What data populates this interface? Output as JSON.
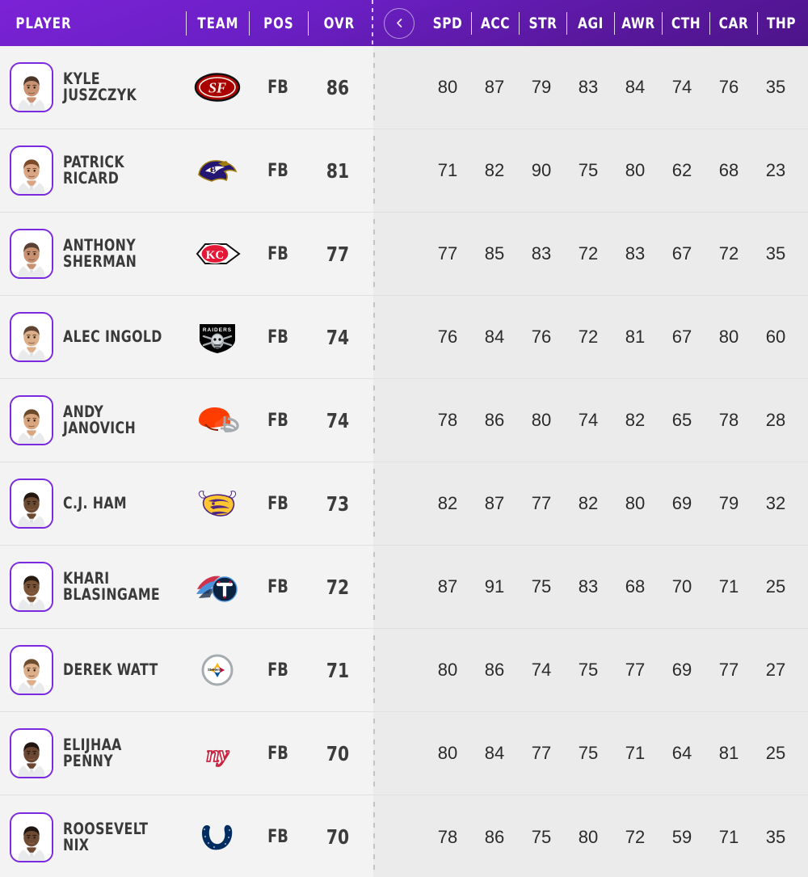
{
  "header": {
    "player_label": "PLAYER",
    "team_label": "TEAM",
    "pos_label": "POS",
    "ovr_label": "OVR",
    "collapse_icon": "chevron-left-icon",
    "stat_labels": [
      "SPD",
      "ACC",
      "STR",
      "AGI",
      "AWR",
      "CTH",
      "CAR",
      "THP"
    ],
    "accent_color": "#7b22d6",
    "accent_color_dark": "#4c1489"
  },
  "theme": {
    "avatar_border": "#7b2ae0",
    "row_bg_left": "#f3f3f3",
    "row_bg_right": "#ebebeb",
    "row_divider": "#e0e0e0",
    "text_color": "#3a3a3a"
  },
  "rows": [
    {
      "name_line1": "KYLE",
      "name_line2": "JUSZCZYK",
      "team": "San Francisco 49ers",
      "team_logo": "49ers-logo",
      "pos": "FB",
      "ovr": "86",
      "stats": [
        "80",
        "87",
        "79",
        "83",
        "84",
        "74",
        "76",
        "35"
      ],
      "avatar": "headshot-kyle-juszczyk",
      "skin": "#c99273",
      "hair": "#4a3526"
    },
    {
      "name_line1": "PATRICK",
      "name_line2": "RICARD",
      "team": "Baltimore Ravens",
      "team_logo": "ravens-logo",
      "pos": "FB",
      "ovr": "81",
      "stats": [
        "71",
        "82",
        "90",
        "75",
        "80",
        "62",
        "68",
        "23"
      ],
      "avatar": "headshot-patrick-ricard",
      "skin": "#d9a583",
      "hair": "#7a4a2a"
    },
    {
      "name_line1": "ANTHONY",
      "name_line2": "SHERMAN",
      "team": "Kansas City Chiefs",
      "team_logo": "chiefs-logo",
      "pos": "FB",
      "ovr": "77",
      "stats": [
        "77",
        "85",
        "83",
        "72",
        "83",
        "67",
        "72",
        "35"
      ],
      "avatar": "headshot-anthony-sherman",
      "skin": "#c89171",
      "hair": "#584032"
    },
    {
      "name_line1": "ALEC  INGOLD",
      "name_line2": "",
      "team": "Las Vegas Raiders",
      "team_logo": "raiders-logo",
      "pos": "FB",
      "ovr": "74",
      "stats": [
        "76",
        "84",
        "76",
        "72",
        "81",
        "67",
        "80",
        "60"
      ],
      "avatar": "headshot-alec-ingold",
      "skin": "#dcaf8b",
      "hair": "#5e4430"
    },
    {
      "name_line1": "ANDY",
      "name_line2": "JANOVICH",
      "team": "Cleveland Browns",
      "team_logo": "browns-logo",
      "pos": "FB",
      "ovr": "74",
      "stats": [
        "78",
        "86",
        "80",
        "74",
        "82",
        "65",
        "78",
        "28"
      ],
      "avatar": "headshot-andy-janovich",
      "skin": "#d8a57f",
      "hair": "#6b4a2c"
    },
    {
      "name_line1": "C.J.  HAM",
      "name_line2": "",
      "team": "Minnesota Vikings",
      "team_logo": "vikings-logo",
      "pos": "FB",
      "ovr": "73",
      "stats": [
        "82",
        "87",
        "77",
        "82",
        "80",
        "69",
        "79",
        "32"
      ],
      "avatar": "headshot-cj-ham",
      "skin": "#6d4a32",
      "hair": "#241710"
    },
    {
      "name_line1": "KHARI",
      "name_line2": "BLASINGAME",
      "team": "Tennessee Titans",
      "team_logo": "titans-logo",
      "pos": "FB",
      "ovr": "72",
      "stats": [
        "87",
        "91",
        "75",
        "83",
        "68",
        "70",
        "71",
        "25"
      ],
      "avatar": "headshot-khari-blasingame",
      "skin": "#7a5336",
      "hair": "#261a11"
    },
    {
      "name_line1": "DEREK  WATT",
      "name_line2": "",
      "team": "Pittsburgh Steelers",
      "team_logo": "steelers-logo",
      "pos": "FB",
      "ovr": "71",
      "stats": [
        "80",
        "86",
        "74",
        "75",
        "77",
        "69",
        "77",
        "27"
      ],
      "avatar": "headshot-derek-watt",
      "skin": "#dcae8a",
      "hair": "#6d4c30"
    },
    {
      "name_line1": "ELIJHAA",
      "name_line2": "PENNY",
      "team": "New York Giants",
      "team_logo": "giants-logo",
      "pos": "FB",
      "ovr": "70",
      "stats": [
        "80",
        "84",
        "77",
        "75",
        "71",
        "64",
        "81",
        "25"
      ],
      "avatar": "headshot-elijhaa-penny",
      "skin": "#6b4630",
      "hair": "#201510"
    },
    {
      "name_line1": "ROOSEVELT",
      "name_line2": "NIX",
      "team": "Indianapolis Colts",
      "team_logo": "colts-logo",
      "pos": "FB",
      "ovr": "70",
      "stats": [
        "78",
        "86",
        "75",
        "80",
        "72",
        "59",
        "71",
        "35"
      ],
      "avatar": "headshot-roosevelt-nix",
      "skin": "#6f4a33",
      "hair": "#1e1410"
    }
  ]
}
